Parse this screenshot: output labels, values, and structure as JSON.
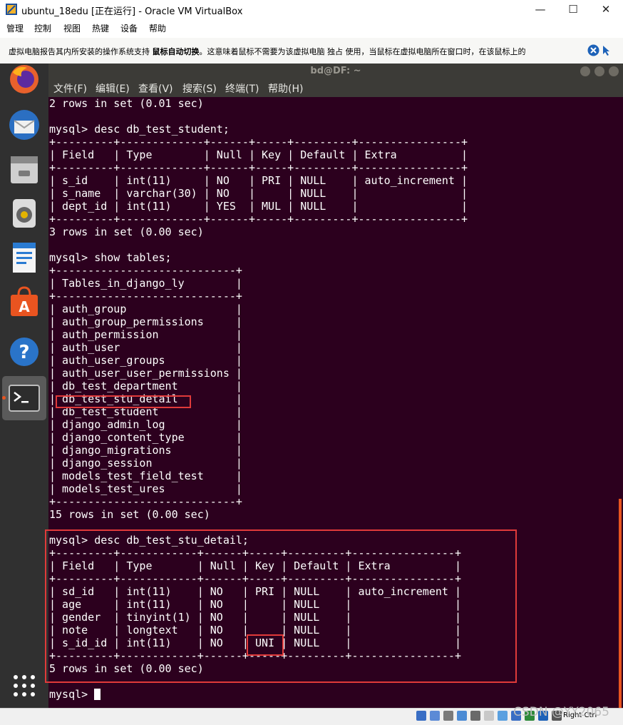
{
  "window": {
    "title": "ubuntu_18edu [正在运行] - Oracle VM VirtualBox",
    "minimize": "—",
    "maximize": "☐",
    "close": "✕"
  },
  "menu": [
    "管理",
    "控制",
    "视图",
    "热键",
    "设备",
    "帮助"
  ],
  "notification": {
    "text_before": "虚拟电脑报告其内所安装的操作系统支持 ",
    "text_bold": "鼠标自动切换",
    "text_after": "。这意味着鼠标不需要为该虚拟电脑 独占 使用，当鼠标在虚拟电脑所在窗口时，在该鼠标上的"
  },
  "terminal": {
    "title": "bd@DF: ~",
    "menu": [
      "文件(F)",
      "编辑(E)",
      "查看(V)",
      "搜索(S)",
      "终端(T)",
      "帮助(H)"
    ],
    "lines": [
      "2 rows in set (0.01 sec)",
      "",
      "mysql> desc db_test_student;",
      "+---------+-------------+------+-----+---------+----------------+",
      "| Field   | Type        | Null | Key | Default | Extra          |",
      "+---------+-------------+------+-----+---------+----------------+",
      "| s_id    | int(11)     | NO   | PRI | NULL    | auto_increment |",
      "| s_name  | varchar(30) | NO   |     | NULL    |                |",
      "| dept_id | int(11)     | YES  | MUL | NULL    |                |",
      "+---------+-------------+------+-----+---------+----------------+",
      "3 rows in set (0.00 sec)",
      "",
      "mysql> show tables;",
      "+----------------------------+",
      "| Tables_in_django_ly        |",
      "+----------------------------+",
      "| auth_group                 |",
      "| auth_group_permissions     |",
      "| auth_permission            |",
      "| auth_user                  |",
      "| auth_user_groups           |",
      "| auth_user_user_permissions |",
      "| db_test_department         |",
      "| db_test_stu_detail         |",
      "| db_test_student            |",
      "| django_admin_log           |",
      "| django_content_type        |",
      "| django_migrations          |",
      "| django_session             |",
      "| models_test_field_test     |",
      "| models_test_ures           |",
      "+----------------------------+",
      "15 rows in set (0.00 sec)",
      "",
      "mysql> desc db_test_stu_detail;",
      "+---------+------------+------+-----+---------+----------------+",
      "| Field   | Type       | Null | Key | Default | Extra          |",
      "+---------+------------+------+-----+---------+----------------+",
      "| sd_id   | int(11)    | NO   | PRI | NULL    | auto_increment |",
      "| age     | int(11)    | NO   |     | NULL    |                |",
      "| gender  | tinyint(1) | NO   |     | NULL    |                |",
      "| note    | longtext   | NO   |     | NULL    |                |",
      "| s_id_id | int(11)    | NO   | UNI | NULL    |                |",
      "+---------+------------+------+-----+---------+----------------+",
      "5 rows in set (0.00 sec)",
      ""
    ],
    "prompt": "mysql> "
  },
  "statusbar": {
    "host_key": "Right Ctrl",
    "watermark": "CSDN @YY2065"
  }
}
